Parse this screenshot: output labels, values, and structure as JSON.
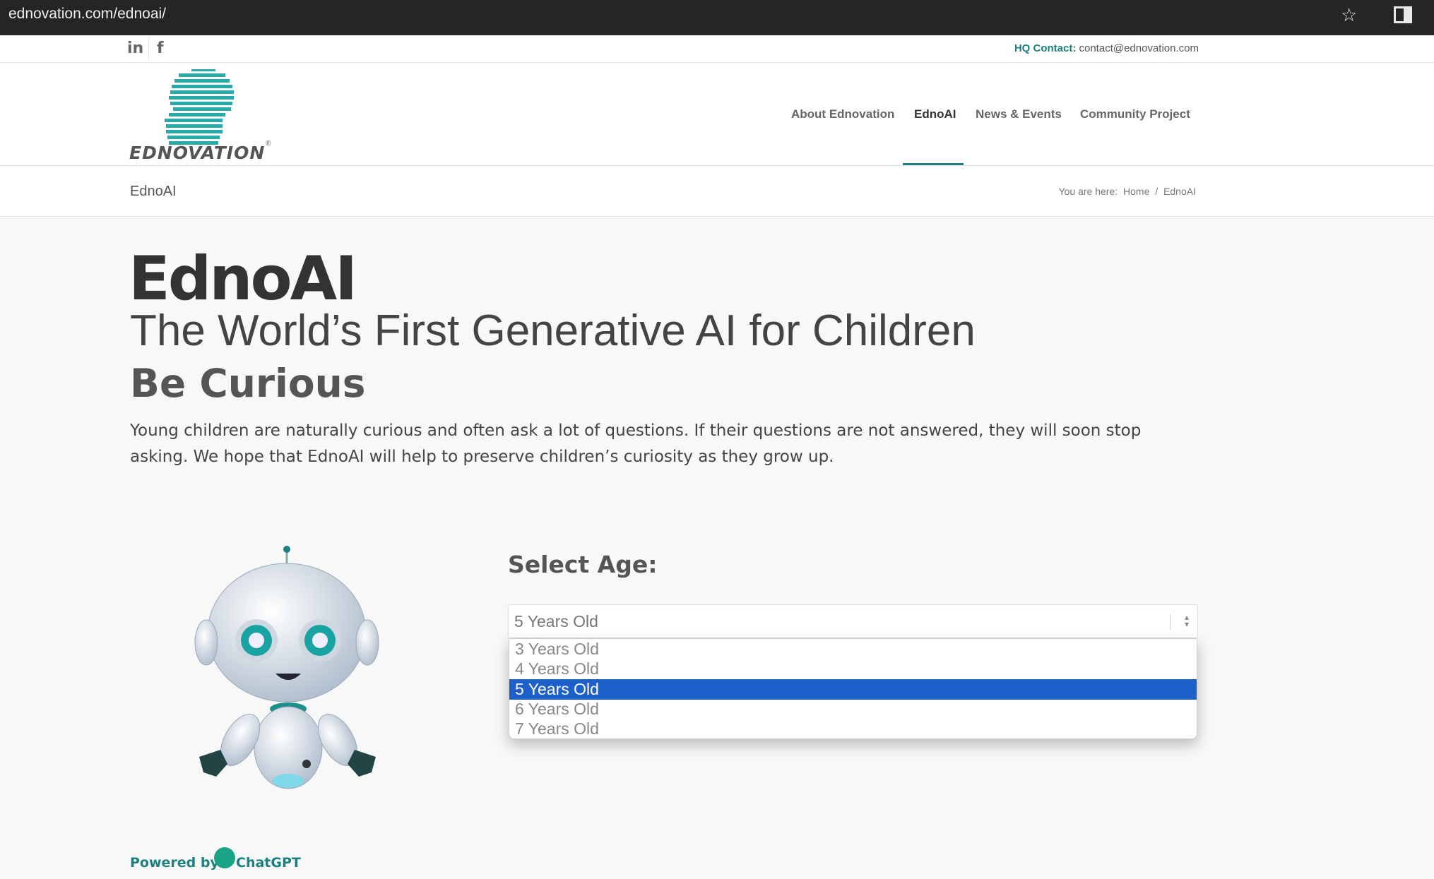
{
  "browser": {
    "url": "ednovation.com/ednoai/"
  },
  "topbar": {
    "social": {
      "linkedin": "in",
      "facebook": "f"
    },
    "hq_label": "HQ Contact:",
    "hq_email": "contact@ednovation.com"
  },
  "header": {
    "logo_text": "EDNOVATION",
    "logo_reg": "®",
    "nav": [
      "About Ednovation",
      "EdnoAI",
      "News & Events",
      "Community Project"
    ],
    "active_nav": "EdnoAI"
  },
  "titlebar": {
    "title": "EdnoAI",
    "breadcrumb_prefix": "You are here:",
    "breadcrumb_home": "Home",
    "breadcrumb_sep": "/",
    "breadcrumb_current": "EdnoAI"
  },
  "content": {
    "title": "EdnoAI",
    "subtitle": "The World’s First Generative AI for Children",
    "heading": "Be Curious",
    "paragraph": "Young children are naturally curious and often ask a lot of questions. If their questions are not answered, they will soon stop asking. We hope that EdnoAI will help to preserve children’s curiosity as they grow up."
  },
  "age_select": {
    "label": "Select Age:",
    "value": "5 Years Old",
    "options": [
      "3 Years Old",
      "4 Years Old",
      "5 Years Old",
      "6 Years Old",
      "7 Years Old"
    ],
    "selected_index": 2
  },
  "footer": {
    "powered_by": "Powered by",
    "brand": "ChatGPT"
  },
  "colors": {
    "accent": "#1d7f7f",
    "highlight": "#1e60c9",
    "logo": "#2aa9a9"
  }
}
